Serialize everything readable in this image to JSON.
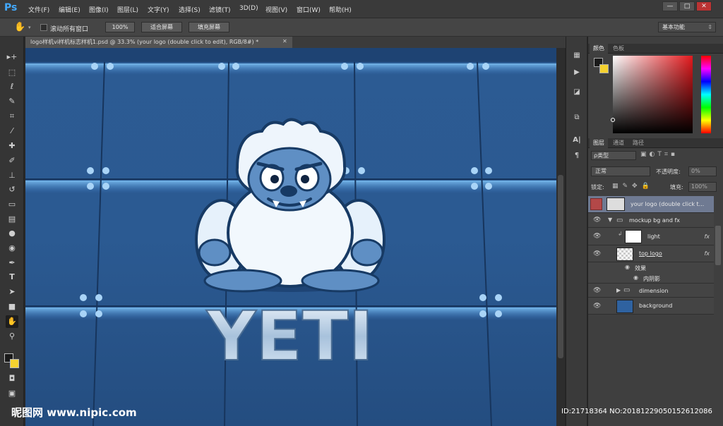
{
  "app": {
    "logo": "Ps"
  },
  "menus": [
    "文件(F)",
    "编辑(E)",
    "图像(I)",
    "图层(L)",
    "文字(Y)",
    "选择(S)",
    "滤镜(T)",
    "3D(D)",
    "视图(V)",
    "窗口(W)",
    "帮助(H)"
  ],
  "window_controls": {
    "minimize": "—",
    "maximize": "□",
    "close": "✕"
  },
  "options": {
    "tool_icon": "hand-icon",
    "scroll_all_label": "滚动所有窗口",
    "zoom_100": "100%",
    "fit_screen": "适合屏幕",
    "fill_screen": "填充屏幕",
    "workspace": "基本功能"
  },
  "document": {
    "tab_title": "logo样机vi样机标志样机1.psd @ 33.3% (your logo (double click to edit), RGB/8#) *",
    "tab_close": "✕"
  },
  "canvas": {
    "logo_text": "YETI"
  },
  "color_panel": {
    "tabs": [
      "颜色",
      "色板"
    ],
    "fg_color": "#1a1a1a",
    "bg_color": "#f5d22f"
  },
  "layers_panel": {
    "tabs": [
      "图层",
      "通道",
      "路径"
    ],
    "filter_label": "ρ类型",
    "blend_mode": "正常",
    "opacity_label": "不透明度:",
    "opacity_value": "0%",
    "lock_label": "锁定:",
    "fill_label": "填充:",
    "fill_value": "100%",
    "layers": [
      {
        "name": "your logo (double click t...",
        "selected": true
      },
      {
        "name": "mockup bg and fx",
        "group": true
      },
      {
        "name": "light",
        "fx": "fx"
      },
      {
        "name": "top logo",
        "fx": "fx"
      },
      {
        "name": "效果",
        "effect": true
      },
      {
        "name": "内阴影",
        "effect": true
      },
      {
        "name": "dimension",
        "group": true
      },
      {
        "name": "background"
      }
    ]
  },
  "watermark": {
    "site": "昵图网 www.nipic.com",
    "id": "ID:21718364 NO:20181229050152612086"
  }
}
